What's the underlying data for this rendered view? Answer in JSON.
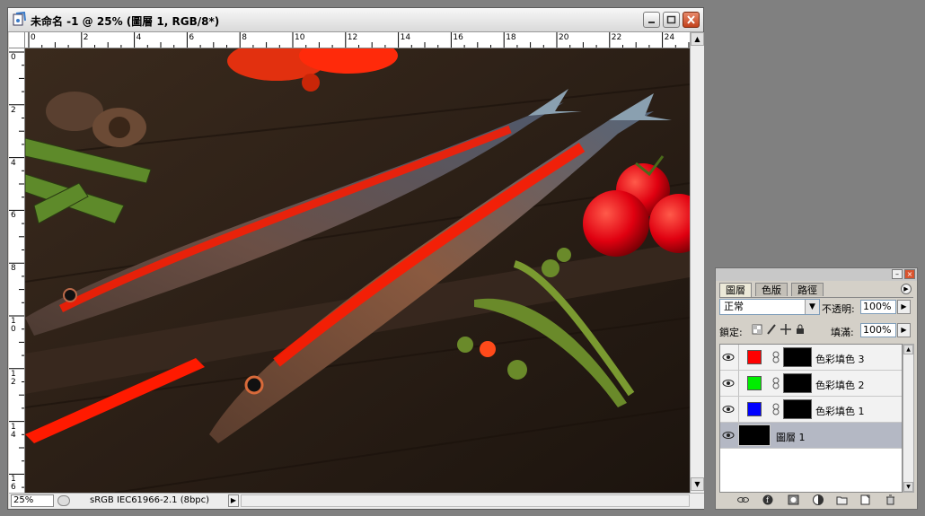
{
  "document": {
    "title": "未命名 -1 @ 25% (圖層 1, RGB/8*)",
    "ruler_h_labels": [
      "0",
      "2",
      "4",
      "6",
      "8",
      "10",
      "12",
      "14",
      "16",
      "18",
      "20",
      "22",
      "24"
    ],
    "ruler_v_labels": [
      "0",
      "2",
      "4",
      "6",
      "8",
      "1 0",
      "1 2",
      "1 4",
      "1 6"
    ],
    "zoom": "25%",
    "status_text": "sRGB IEC61966-2.1 (8bpc)"
  },
  "layers_panel": {
    "tabs": [
      {
        "label": "圖層",
        "active": true
      },
      {
        "label": "色版",
        "active": false
      },
      {
        "label": "路徑",
        "active": false
      }
    ],
    "blend_mode": "正常",
    "opacity_label": "不透明:",
    "opacity_value": "100%",
    "lock_label": "鎖定:",
    "fill_label": "填滿:",
    "fill_value": "100%",
    "layers": [
      {
        "name": "色彩填色 3",
        "swatch_color": "#ff0000",
        "selected": false
      },
      {
        "name": "色彩填色 2",
        "swatch_color": "#00ee00",
        "selected": false
      },
      {
        "name": "色彩填色 1",
        "swatch_color": "#0000ff",
        "selected": false
      },
      {
        "name": "圖層 1",
        "swatch_color": "#000000",
        "selected": true
      }
    ]
  },
  "colors": {
    "canvas_background": "#2a1d14",
    "accent_red": "#ff1a00",
    "close_button": "#c2411b"
  }
}
